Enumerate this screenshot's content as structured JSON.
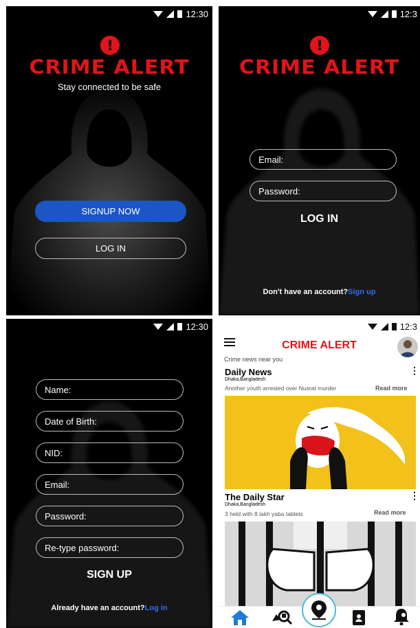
{
  "status_bar": {
    "time_full": "12:30",
    "time_cut": "12:3"
  },
  "brand": {
    "app_name": "CRIME ALERT",
    "alert_glyph": "!"
  },
  "splash": {
    "tagline": "Stay connected to be safe",
    "signup_button": "SIGNUP NOW",
    "login_button": "LOG IN"
  },
  "login": {
    "email_placeholder": "Email:",
    "password_placeholder": "Password:",
    "submit": "LOG IN",
    "footer_text": "Don't have an account?",
    "footer_link": "Sign up"
  },
  "signup": {
    "fields": [
      "Name:",
      "Date of Birth:",
      "NID:",
      "Email:",
      "Password:",
      "Re-type password:"
    ],
    "submit": "SIGN UP",
    "footer_text": "Already have an account?",
    "footer_link": "Log in"
  },
  "feed": {
    "title": "CRIME ALERT",
    "subtitle": "Crime news near you",
    "read_more": "Read more",
    "cards": [
      {
        "source": "Daily News",
        "location": "Dhaka,Bangladesh",
        "headline": "Another youth arrested over Nusrat murder"
      },
      {
        "source": "The Daily Star",
        "location": "Dhaka,Bangladesh",
        "headline": "3 held with 8 lakh yaba tablets"
      }
    ]
  },
  "icons": [
    "wifi-icon",
    "signal-icon",
    "battery-icon",
    "menu-icon",
    "avatar",
    "kebab-icon",
    "home-icon",
    "search-news-icon",
    "map-pin-icon",
    "contacts-icon",
    "notification-icon"
  ],
  "colors": {
    "brand_red": "#e0141a",
    "primary_blue": "#1b56c4",
    "link_blue": "#2f6df0",
    "background": "#000000",
    "home_blue": "#1e7ad8"
  }
}
